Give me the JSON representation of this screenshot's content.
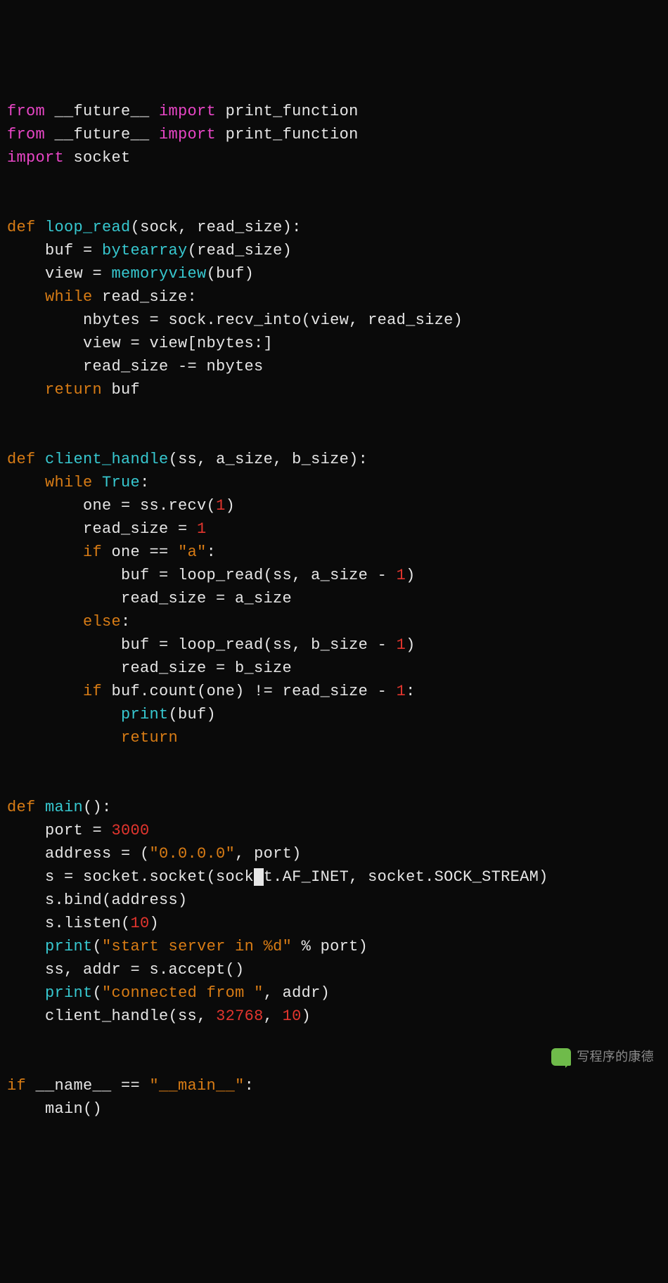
{
  "code": {
    "lines": [
      [
        {
          "t": "from",
          "c": "kw-import"
        },
        {
          "t": " __future__ ",
          "c": "text"
        },
        {
          "t": "import",
          "c": "kw-import"
        },
        {
          "t": " print_function",
          "c": "text"
        }
      ],
      [
        {
          "t": "from",
          "c": "kw-import"
        },
        {
          "t": " __future__ ",
          "c": "text"
        },
        {
          "t": "import",
          "c": "kw-import"
        },
        {
          "t": " print_function",
          "c": "text"
        }
      ],
      [
        {
          "t": "import",
          "c": "kw-import"
        },
        {
          "t": " socket",
          "c": "text"
        }
      ],
      [],
      [],
      [
        {
          "t": "def",
          "c": "kw-def"
        },
        {
          "t": " ",
          "c": "text"
        },
        {
          "t": "loop_read",
          "c": "fn-name"
        },
        {
          "t": "(sock, read_size):",
          "c": "text"
        }
      ],
      [
        {
          "t": "    buf = ",
          "c": "text"
        },
        {
          "t": "bytearray",
          "c": "builtin"
        },
        {
          "t": "(read_size)",
          "c": "text"
        }
      ],
      [
        {
          "t": "    view = ",
          "c": "text"
        },
        {
          "t": "memoryview",
          "c": "builtin"
        },
        {
          "t": "(buf)",
          "c": "text"
        }
      ],
      [
        {
          "t": "    ",
          "c": "text"
        },
        {
          "t": "while",
          "c": "kw-ctrl"
        },
        {
          "t": " read_size:",
          "c": "text"
        }
      ],
      [
        {
          "t": "        nbytes = sock.recv_into(view, read_size)",
          "c": "text"
        }
      ],
      [
        {
          "t": "        view = view[nbytes:]",
          "c": "text"
        }
      ],
      [
        {
          "t": "        read_size -= nbytes",
          "c": "text"
        }
      ],
      [
        {
          "t": "    ",
          "c": "text"
        },
        {
          "t": "return",
          "c": "kw-ctrl"
        },
        {
          "t": " buf",
          "c": "text"
        }
      ],
      [],
      [],
      [
        {
          "t": "def",
          "c": "kw-def"
        },
        {
          "t": " ",
          "c": "text"
        },
        {
          "t": "client_handle",
          "c": "fn-name"
        },
        {
          "t": "(ss, a_size, b_size):",
          "c": "text"
        }
      ],
      [
        {
          "t": "    ",
          "c": "text"
        },
        {
          "t": "while",
          "c": "kw-ctrl"
        },
        {
          "t": " ",
          "c": "text"
        },
        {
          "t": "True",
          "c": "bool"
        },
        {
          "t": ":",
          "c": "text"
        }
      ],
      [
        {
          "t": "        one = ss.recv(",
          "c": "text"
        },
        {
          "t": "1",
          "c": "num"
        },
        {
          "t": ")",
          "c": "text"
        }
      ],
      [
        {
          "t": "        read_size = ",
          "c": "text"
        },
        {
          "t": "1",
          "c": "num"
        }
      ],
      [
        {
          "t": "        ",
          "c": "text"
        },
        {
          "t": "if",
          "c": "kw-ctrl"
        },
        {
          "t": " one == ",
          "c": "text"
        },
        {
          "t": "\"a\"",
          "c": "str"
        },
        {
          "t": ":",
          "c": "text"
        }
      ],
      [
        {
          "t": "            buf = loop_read(ss, a_size - ",
          "c": "text"
        },
        {
          "t": "1",
          "c": "num"
        },
        {
          "t": ")",
          "c": "text"
        }
      ],
      [
        {
          "t": "            read_size = a_size",
          "c": "text"
        }
      ],
      [
        {
          "t": "        ",
          "c": "text"
        },
        {
          "t": "else",
          "c": "kw-ctrl"
        },
        {
          "t": ":",
          "c": "text"
        }
      ],
      [
        {
          "t": "            buf = loop_read(ss, b_size - ",
          "c": "text"
        },
        {
          "t": "1",
          "c": "num"
        },
        {
          "t": ")",
          "c": "text"
        }
      ],
      [
        {
          "t": "            read_size = b_size",
          "c": "text"
        }
      ],
      [
        {
          "t": "        ",
          "c": "text"
        },
        {
          "t": "if",
          "c": "kw-ctrl"
        },
        {
          "t": " buf.count(one) != read_size - ",
          "c": "text"
        },
        {
          "t": "1",
          "c": "num"
        },
        {
          "t": ":",
          "c": "text"
        }
      ],
      [
        {
          "t": "            ",
          "c": "text"
        },
        {
          "t": "print",
          "c": "builtin"
        },
        {
          "t": "(buf)",
          "c": "text"
        }
      ],
      [
        {
          "t": "            ",
          "c": "text"
        },
        {
          "t": "return",
          "c": "kw-ctrl"
        }
      ],
      [],
      [],
      [
        {
          "t": "def",
          "c": "kw-def"
        },
        {
          "t": " ",
          "c": "text"
        },
        {
          "t": "main",
          "c": "fn-name"
        },
        {
          "t": "():",
          "c": "text"
        }
      ],
      [
        {
          "t": "    port = ",
          "c": "text"
        },
        {
          "t": "3000",
          "c": "num"
        }
      ],
      [
        {
          "t": "    address = (",
          "c": "text"
        },
        {
          "t": "\"0.0.0.0\"",
          "c": "str"
        },
        {
          "t": ", port)",
          "c": "text"
        }
      ],
      [
        {
          "t": "    s = socket.socket(sock",
          "c": "text"
        },
        {
          "t": "e",
          "c": "cursor"
        },
        {
          "t": "t.AF_INET, socket.SOCK_STREAM)",
          "c": "text"
        }
      ],
      [
        {
          "t": "    s.bind(address)",
          "c": "text"
        }
      ],
      [
        {
          "t": "    s.listen(",
          "c": "text"
        },
        {
          "t": "10",
          "c": "num"
        },
        {
          "t": ")",
          "c": "text"
        }
      ],
      [
        {
          "t": "    ",
          "c": "text"
        },
        {
          "t": "print",
          "c": "builtin"
        },
        {
          "t": "(",
          "c": "text"
        },
        {
          "t": "\"start server in %d\"",
          "c": "str"
        },
        {
          "t": " % port)",
          "c": "text"
        }
      ],
      [
        {
          "t": "    ss, addr = s.accept()",
          "c": "text"
        }
      ],
      [
        {
          "t": "    ",
          "c": "text"
        },
        {
          "t": "print",
          "c": "builtin"
        },
        {
          "t": "(",
          "c": "text"
        },
        {
          "t": "\"connected from \"",
          "c": "str"
        },
        {
          "t": ", addr)",
          "c": "text"
        }
      ],
      [
        {
          "t": "    client_handle(ss, ",
          "c": "text"
        },
        {
          "t": "32768",
          "c": "num"
        },
        {
          "t": ", ",
          "c": "text"
        },
        {
          "t": "10",
          "c": "num"
        },
        {
          "t": ")",
          "c": "text"
        }
      ],
      [],
      [],
      [
        {
          "t": "if",
          "c": "kw-ctrl"
        },
        {
          "t": " __name__ == ",
          "c": "text"
        },
        {
          "t": "\"__main__\"",
          "c": "str"
        },
        {
          "t": ":",
          "c": "text"
        }
      ],
      [
        {
          "t": "    main()",
          "c": "text"
        }
      ]
    ]
  },
  "watermark": {
    "label": "写程序的康德"
  }
}
